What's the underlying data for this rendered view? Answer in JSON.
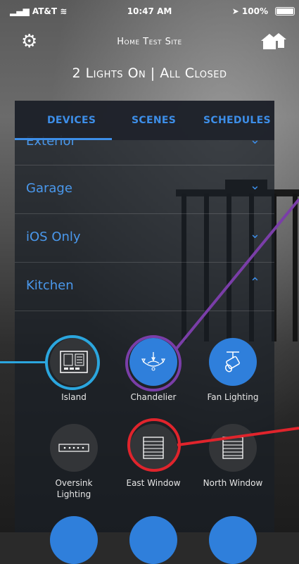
{
  "status_bar": {
    "carrier": "AT&T",
    "time": "10:47 AM",
    "battery": "100%"
  },
  "header": {
    "site_name": "Home Test Site",
    "summary": "2 Lights On | All Closed"
  },
  "tabs": [
    {
      "label": "DEVICES",
      "selected": true
    },
    {
      "label": "SCENES",
      "selected": false
    },
    {
      "label": "SCHEDULES",
      "selected": false
    }
  ],
  "rooms": [
    {
      "label": "Exterior",
      "expanded": false
    },
    {
      "label": "Garage",
      "expanded": false
    },
    {
      "label": "iOS Only",
      "expanded": false
    },
    {
      "label": "Kitchen",
      "expanded": true
    }
  ],
  "devices": [
    {
      "name": "Island",
      "state": "off",
      "icon": "keypad-icon"
    },
    {
      "name": "Chandelier",
      "state": "on",
      "icon": "chandelier-icon"
    },
    {
      "name": "Fan Lighting",
      "state": "on",
      "icon": "spotlight-icon"
    },
    {
      "name": "Oversink Lighting",
      "state": "off",
      "icon": "light-strip-icon"
    },
    {
      "name": "East Window",
      "state": "off",
      "icon": "window-shade-icon"
    },
    {
      "name": "North Window",
      "state": "off",
      "icon": "window-shade-icon"
    }
  ],
  "colors": {
    "accent": "#3d8ee8",
    "device_on": "#2f7fdb",
    "device_off": "#333538",
    "callout_cyan": "#2ba6de",
    "callout_purple": "#7a3ea8",
    "callout_red": "#e0242c"
  }
}
